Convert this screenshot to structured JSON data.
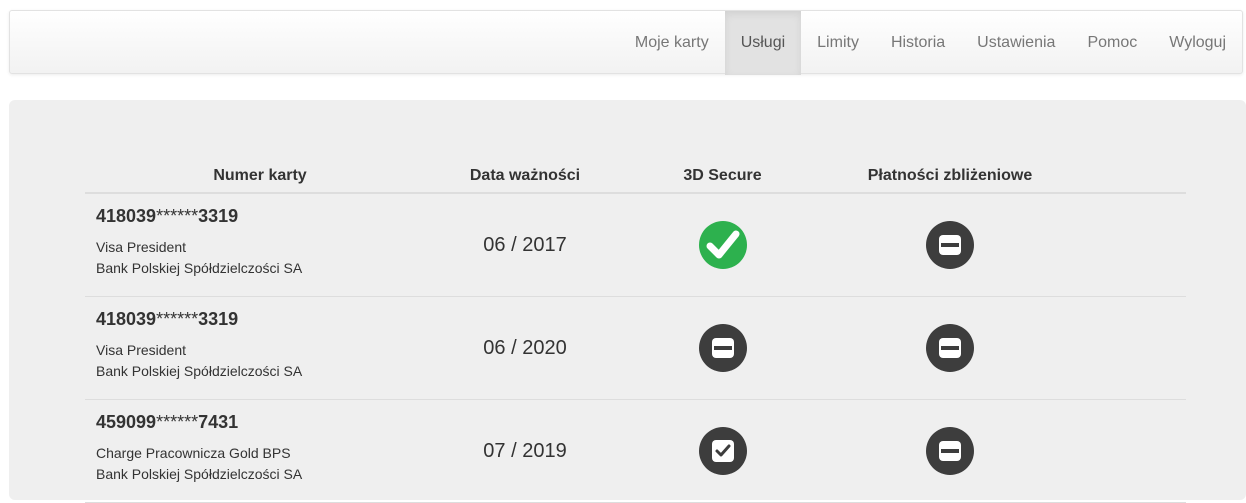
{
  "nav": {
    "items": [
      {
        "label": "Moje karty",
        "active": false
      },
      {
        "label": "Usługi",
        "active": true
      },
      {
        "label": "Limity",
        "active": false
      },
      {
        "label": "Historia",
        "active": false
      },
      {
        "label": "Ustawienia",
        "active": false
      },
      {
        "label": "Pomoc",
        "active": false
      },
      {
        "label": "Wyloguj",
        "active": false
      }
    ]
  },
  "table": {
    "headers": {
      "card_number": "Numer karty",
      "expiry": "Data ważności",
      "secure3d": "3D Secure",
      "contactless": "Płatności zbliżeniowe"
    },
    "rows": [
      {
        "number_prefix": "418039",
        "number_mask": "******",
        "number_suffix": "3319",
        "card_type": "Visa President",
        "bank": "Bank Polskiej Spółdzielczości SA",
        "expiry": "06 / 2017",
        "secure3d_state": "enabled-green-check",
        "contactless_state": "disabled-minus"
      },
      {
        "number_prefix": "418039",
        "number_mask": "******",
        "number_suffix": "3319",
        "card_type": "Visa President",
        "bank": "Bank Polskiej Spółdzielczości SA",
        "expiry": "06 / 2020",
        "secure3d_state": "disabled-minus",
        "contactless_state": "disabled-minus"
      },
      {
        "number_prefix": "459099",
        "number_mask": "******",
        "number_suffix": "7431",
        "card_type": "Charge Pracownicza Gold BPS",
        "bank": "Bank Polskiej Spółdzielczości SA",
        "expiry": "07 / 2019",
        "secure3d_state": "checkbox-checked",
        "contactless_state": "disabled-minus"
      }
    ]
  },
  "colors": {
    "accent_green": "#2db14e",
    "icon_dark": "#3d3d3d",
    "panel_bg": "#efefef",
    "nav_active_bg": "#e2e2e2"
  }
}
